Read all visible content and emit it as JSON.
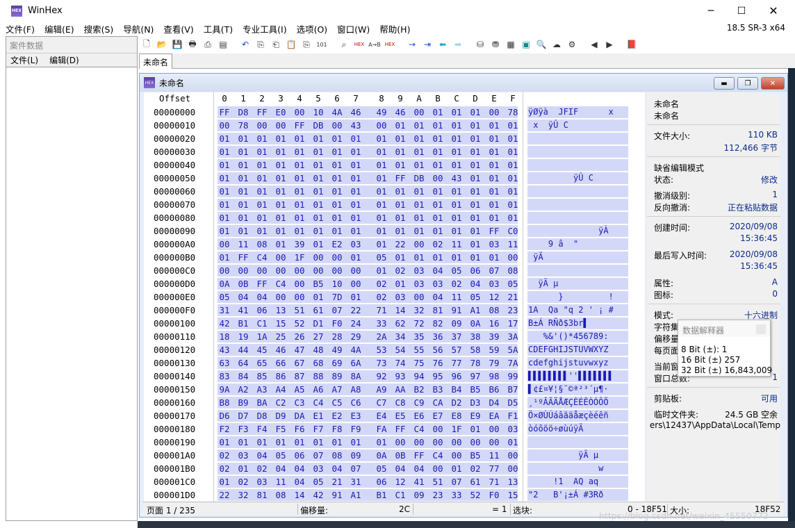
{
  "window": {
    "title": "WinHex",
    "version": "18.5 SR-3 x64"
  },
  "menu": [
    "文件(F)",
    "编辑(E)",
    "搜索(S)",
    "导航(N)",
    "查看(V)",
    "工具(T)",
    "专业工具(I)",
    "选项(O)",
    "窗口(W)",
    "帮助(H)"
  ],
  "left_pane": {
    "title": "案件数据",
    "menu": [
      "文件(L)",
      "编辑(D)"
    ]
  },
  "doc_tab": "未命名",
  "doc_window": {
    "title": "未命名"
  },
  "hex": {
    "offset_label": "Offset",
    "columns": [
      "0",
      "1",
      "2",
      "3",
      "4",
      "5",
      "6",
      "7",
      "8",
      "9",
      "A",
      "B",
      "C",
      "D",
      "E",
      "F"
    ],
    "rows": [
      {
        "off": "00000000",
        "bytes": "FF D8 FF E0 00 10 4A 46 49 46 00 01 01 01 00 78",
        "ascii": "ÿØÿà  JFIF      x"
      },
      {
        "off": "00000010",
        "bytes": "00 78 00 00 FF DB 00 43 00 01 01 01 01 01 01 01",
        "ascii": " x  ÿÛ C"
      },
      {
        "off": "00000020",
        "bytes": "01 01 01 01 01 01 01 01 01 01 01 01 01 01 01 01",
        "ascii": ""
      },
      {
        "off": "00000030",
        "bytes": "01 01 01 01 01 01 01 01 01 01 01 01 01 01 01 01",
        "ascii": ""
      },
      {
        "off": "00000040",
        "bytes": "01 01 01 01 01 01 01 01 01 01 01 01 01 01 01 01",
        "ascii": ""
      },
      {
        "off": "00000050",
        "bytes": "01 01 01 01 01 01 01 01 01 FF DB 00 43 01 01 01",
        "ascii": "         ÿÛ C"
      },
      {
        "off": "00000060",
        "bytes": "01 01 01 01 01 01 01 01 01 01 01 01 01 01 01 01",
        "ascii": ""
      },
      {
        "off": "00000070",
        "bytes": "01 01 01 01 01 01 01 01 01 01 01 01 01 01 01 01",
        "ascii": ""
      },
      {
        "off": "00000080",
        "bytes": "01 01 01 01 01 01 01 01 01 01 01 01 01 01 01 01",
        "ascii": ""
      },
      {
        "off": "00000090",
        "bytes": "01 01 01 01 01 01 01 01 01 01 01 01 01 01 FF C0",
        "ascii": "              ÿÀ"
      },
      {
        "off": "000000A0",
        "bytes": "00 11 08 01 39 01 E2 03 01 22 00 02 11 01 03 11",
        "ascii": "    9 â  \""
      },
      {
        "off": "000000B0",
        "bytes": "01 FF C4 00 1F 00 00 01 05 01 01 01 01 01 01 00",
        "ascii": " ÿÄ"
      },
      {
        "off": "000000C0",
        "bytes": "00 00 00 00 00 00 00 00 01 02 03 04 05 06 07 08 09",
        "ascii": ""
      },
      {
        "off": "000000D0",
        "bytes": "0A 0B FF C4 00 B5 10 00 02 01 03 03 02 04 03 05",
        "ascii": "  ÿÄ µ"
      },
      {
        "off": "000000E0",
        "bytes": "05 04 04 00 00 01 7D 01 02 03 00 04 11 05 12 21",
        "ascii": "      }         !"
      },
      {
        "off": "000000F0",
        "bytes": "31 41 06 13 51 61 07 22 71 14 32 81 91 A1 08 23",
        "ascii": "1A  Qa \"q 2 ' ¡ #"
      },
      {
        "off": "00000100",
        "bytes": "42 B1 C1 15 52 D1 F0 24 33 62 72 82 09 0A 16 17",
        "ascii": "B±Á RÑð$3br▌"
      },
      {
        "off": "00000110",
        "bytes": "18 19 1A 25 26 27 28 29 2A 34 35 36 37 38 39 3A",
        "ascii": "   %&'()*456789:"
      },
      {
        "off": "00000120",
        "bytes": "43 44 45 46 47 48 49 4A 53 54 55 56 57 58 59 5A",
        "ascii": "CDEFGHIJSTUVWXYZ"
      },
      {
        "off": "00000130",
        "bytes": "63 64 65 66 67 68 69 6A 73 74 75 76 77 78 79 7A",
        "ascii": "cdefghijstuvwxyz"
      },
      {
        "off": "00000140",
        "bytes": "83 84 85 86 87 88 89 8A 92 93 94 95 96 97 98 99",
        "ascii": "▌▌▌▌▌▌▌▌''▌▌▌▌▌▌▌"
      },
      {
        "off": "00000150",
        "bytes": "9A A2 A3 A4 A5 A6 A7 A8 A9 AA B2 B3 B4 B5 B6 B7",
        "ascii": "▌¢£¤¥¦§¨©ª²³´µ¶·"
      },
      {
        "off": "00000160",
        "bytes": "B8 B9 BA C2 C3 C4 C5 C6 C7 C8 C9 CA D2 D3 D4 D5",
        "ascii": "¸¹ºÂÃÄÅÆÇÈÉÊÒÓÔÕ"
      },
      {
        "off": "00000170",
        "bytes": "D6 D7 D8 D9 DA E1 E2 E3 E4 E5 E6 E7 E8 E9 EA F1",
        "ascii": "Ö×ØÙÚáâãäåæçèéêñ"
      },
      {
        "off": "00000180",
        "bytes": "F2 F3 F4 F5 F6 F7 F8 F9 FA FF C4 00 1F 01 00 03",
        "ascii": "òóôõö÷øùúÿÄ"
      },
      {
        "off": "00000190",
        "bytes": "01 01 01 01 01 01 01 01 01 00 00 00 00 00 00 01",
        "ascii": ""
      },
      {
        "off": "000001A0",
        "bytes": "02 03 04 05 06 07 08 09 0A 0B FF C4 00 B5 11 00",
        "ascii": "          ÿÄ µ"
      },
      {
        "off": "000001B0",
        "bytes": "02 01 02 04 04 03 04 07 05 04 04 00 01 02 77 00",
        "ascii": "              w"
      },
      {
        "off": "000001C0",
        "bytes": "01 02 03 11 04 05 21 31 06 12 41 51 07 61 71 13",
        "ascii": "     !1  AQ aq"
      },
      {
        "off": "000001D0",
        "bytes": "22 32 81 08 14 42 91 A1 B1 C1 09 23 33 52 F0 15",
        "ascii": "\"2   B'¡±Á #3Rð"
      }
    ]
  },
  "info": {
    "name1": "未命名",
    "name2": "未命名",
    "size_label": "文件大小:",
    "size_kb": "110 KB",
    "size_bytes": "112,466 字节",
    "edit_mode": "缺省编辑模式",
    "state_label": "状态:",
    "state_value": "修改",
    "undo_level_label": "撤消级别:",
    "undo_level_value": "1",
    "undo_reverse_label": "反向撤消:",
    "undo_reverse_value": "正在粘贴数据",
    "created_label": "创建时间:",
    "created_date": "2020/09/08",
    "created_time": "15:36:45",
    "written_label": "最后写入时间:",
    "written_date": "2020/09/08",
    "written_time": "15:36:45",
    "attr_label": "属性:",
    "attr_value": "A",
    "icon_label": "图标:",
    "icon_value": "0",
    "mode_label": "模式:",
    "mode_value": "十六进制",
    "charset_label": "字符集",
    "offset_label": "偏移量",
    "perpage_label": "每页面",
    "curwin_label": "当前窗",
    "totalwin_label": "窗口总数:",
    "totalwin_value": "1",
    "clip_label": "剪贴板:",
    "clip_value": "可用",
    "temp_label": "临时文件夹:",
    "temp_value": "24.5 GB 空余",
    "temp_path": "ers\\12437\\AppData\\Local\\Temp"
  },
  "interpreter": {
    "title": "数据解释器",
    "bit8": "8 Bit (±): 1",
    "bit16": "16 Bit (±) 257",
    "bit32": "32 Bit (±) 16,843,009"
  },
  "status": {
    "page": "页面 1 / 235",
    "offset_label": "偏移量:",
    "offset_value": "2C",
    "eq": "= 1",
    "select_label": "选块:",
    "select_value": "0 - 18F51",
    "size_label": "大小:",
    "size_value": "18F52"
  },
  "watermark": "https://blog.csdn.net/weixin_45550772",
  "colors": {
    "hex_text": "#1a1ab0",
    "selection_bg": "#d4d8f8",
    "panel_value": "#0a2a8a"
  }
}
